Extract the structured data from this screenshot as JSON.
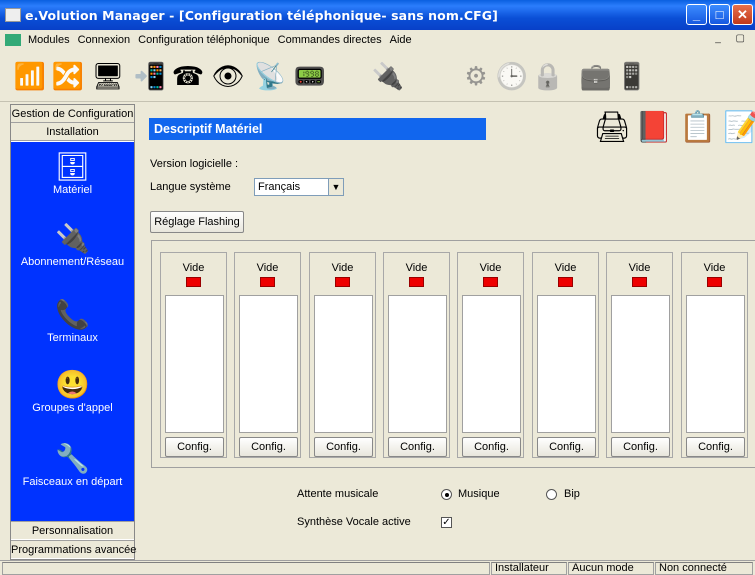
{
  "window": {
    "title": "e.Volution Manager - [Configuration téléphonique- sans nom.CFG]",
    "minimize_glyph": "_",
    "maximize_glyph": "□",
    "close_glyph": "✕"
  },
  "menu": [
    "Modules",
    "Connexion",
    "Configuration téléphonique",
    "Commandes directes",
    "Aide"
  ],
  "mdi_controls": "_ ▢",
  "toolbar": {
    "icons": [
      {
        "name": "antenna-icon",
        "glyph": "📶"
      },
      {
        "name": "network-cable-icon",
        "glyph": "🔀"
      },
      {
        "name": "pc-icon",
        "glyph": "🖥"
      },
      {
        "name": "handset-icon",
        "glyph": "📲"
      },
      {
        "name": "phone-icon",
        "glyph": "☎"
      },
      {
        "name": "eye-icon",
        "glyph": "👁"
      },
      {
        "name": "connection-icon",
        "glyph": "📡"
      },
      {
        "name": "terminal-icon",
        "glyph": "📟"
      },
      {
        "name": "transfer-icon",
        "glyph": "🔌"
      },
      {
        "name": "wheel-icon",
        "glyph": "⚙"
      },
      {
        "name": "clock-icon",
        "glyph": "🕒"
      },
      {
        "name": "lock-icon",
        "glyph": "🔒"
      },
      {
        "name": "first-aid-icon",
        "glyph": "💼"
      },
      {
        "name": "mobile-icon",
        "glyph": "📱"
      }
    ]
  },
  "sidebar": {
    "header": "Gestion de Configuration",
    "active_section": "Installation",
    "items": [
      {
        "label": "Matériel",
        "glyph": "🗄"
      },
      {
        "label": "Abonnement/Réseau",
        "glyph": "🔌"
      },
      {
        "label": "Terminaux",
        "glyph": "📞"
      },
      {
        "label": "Groupes d'appel",
        "glyph": "😃"
      },
      {
        "label": "Faisceaux en départ",
        "glyph": "🔧"
      }
    ],
    "footer_1": "Personnalisation",
    "footer_2": "Programmations avancées"
  },
  "main": {
    "section_title": "Descriptif Matériel",
    "version_label": "Version logicielle :",
    "language_label": "Langue système",
    "language_value": "Français",
    "flashing_button": "Réglage Flashing",
    "header_icons": [
      {
        "name": "printer-icon",
        "glyph": "🖨"
      },
      {
        "name": "help-book-icon",
        "glyph": "📕"
      },
      {
        "name": "checklist-icon",
        "glyph": "📋"
      },
      {
        "name": "edit-icon",
        "glyph": "📝"
      }
    ],
    "slots": [
      {
        "label": "Vide",
        "button": "Config."
      },
      {
        "label": "Vide",
        "button": "Config."
      },
      {
        "label": "Vide",
        "button": "Config."
      },
      {
        "label": "Vide",
        "button": "Config."
      },
      {
        "label": "Vide",
        "button": "Config."
      },
      {
        "label": "Vide",
        "button": "Config."
      },
      {
        "label": "Vide",
        "button": "Config."
      },
      {
        "label": "Vide",
        "button": "Config."
      }
    ],
    "music_label": "Attente musicale",
    "music_option_1": "Musique",
    "music_option_2": "Bip",
    "voice_label": "Synthèse Vocale active",
    "voice_checked": true
  },
  "status": [
    "Installateur",
    "Aucun mode",
    "Non connecté"
  ]
}
